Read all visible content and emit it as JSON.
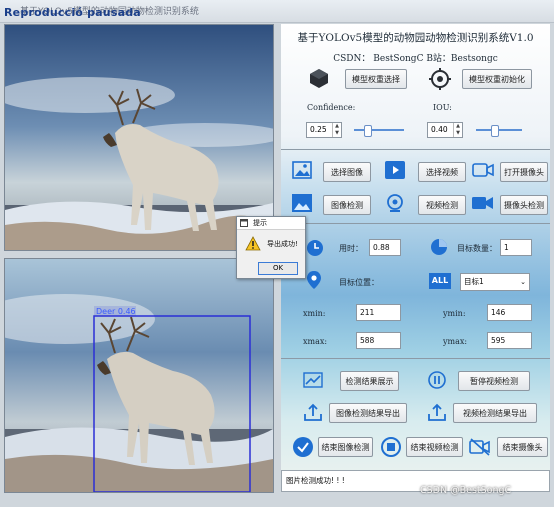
{
  "window": {
    "title": "基于YOLOv5模型的动物园动物检测识别系统",
    "overlay": "Reproducció pausada"
  },
  "detection": {
    "box_label": "Deer  0.46"
  },
  "panel": {
    "title": "基于YOLOv5模型的动物园动物检测识别系统V1.0",
    "subtitle": "CSDN：  BestSongC   B站：Bestsongc",
    "load_model_button": "模型权重选择",
    "init_model_button": "模型权重初始化",
    "confidence_label": "Confidence:",
    "iou_label": "IOU:",
    "confidence_value": "0.25",
    "iou_value": "0.40",
    "confidence_level": 0.25,
    "iou_level": 0.4,
    "select_image_button": "选择图像",
    "select_video_button": "选择视频",
    "open_camera_button": "打开摄像头",
    "image_detect_button": "图像检测",
    "video_detect_button": "视频检测",
    "camera_detect_button": "摄像头检测",
    "time_label": "用时：",
    "time_value": "0.88",
    "count_label": "目标数量：",
    "count_value": "1",
    "position_label": "目标位置：",
    "target_select": "目标1",
    "xmin_label": "xmin:",
    "xmin_value": "211",
    "ymin_label": "ymin:",
    "ymin_value": "146",
    "xmax_label": "xmax:",
    "xmax_value": "588",
    "ymax_label": "ymax:",
    "ymax_value": "595",
    "show_results_button": "检测结果展示",
    "pause_video_button": "暂停视频检测",
    "export_image_button": "图像检测结果导出",
    "export_video_button": "视频检测结果导出",
    "stop_image_button": "结束图像检测",
    "stop_video_button": "结束视频检测",
    "stop_camera_button": "结束摄像头",
    "status_text": "图片检测成功! ! !"
  },
  "dialog": {
    "title": "提示",
    "message": "导出成功!",
    "ok": "OK"
  },
  "watermark": "CSDN @BestSongC",
  "colors": {
    "accent": "#1f6fd1",
    "box": "#2b2fd6",
    "box_label": "#3a5cff"
  }
}
